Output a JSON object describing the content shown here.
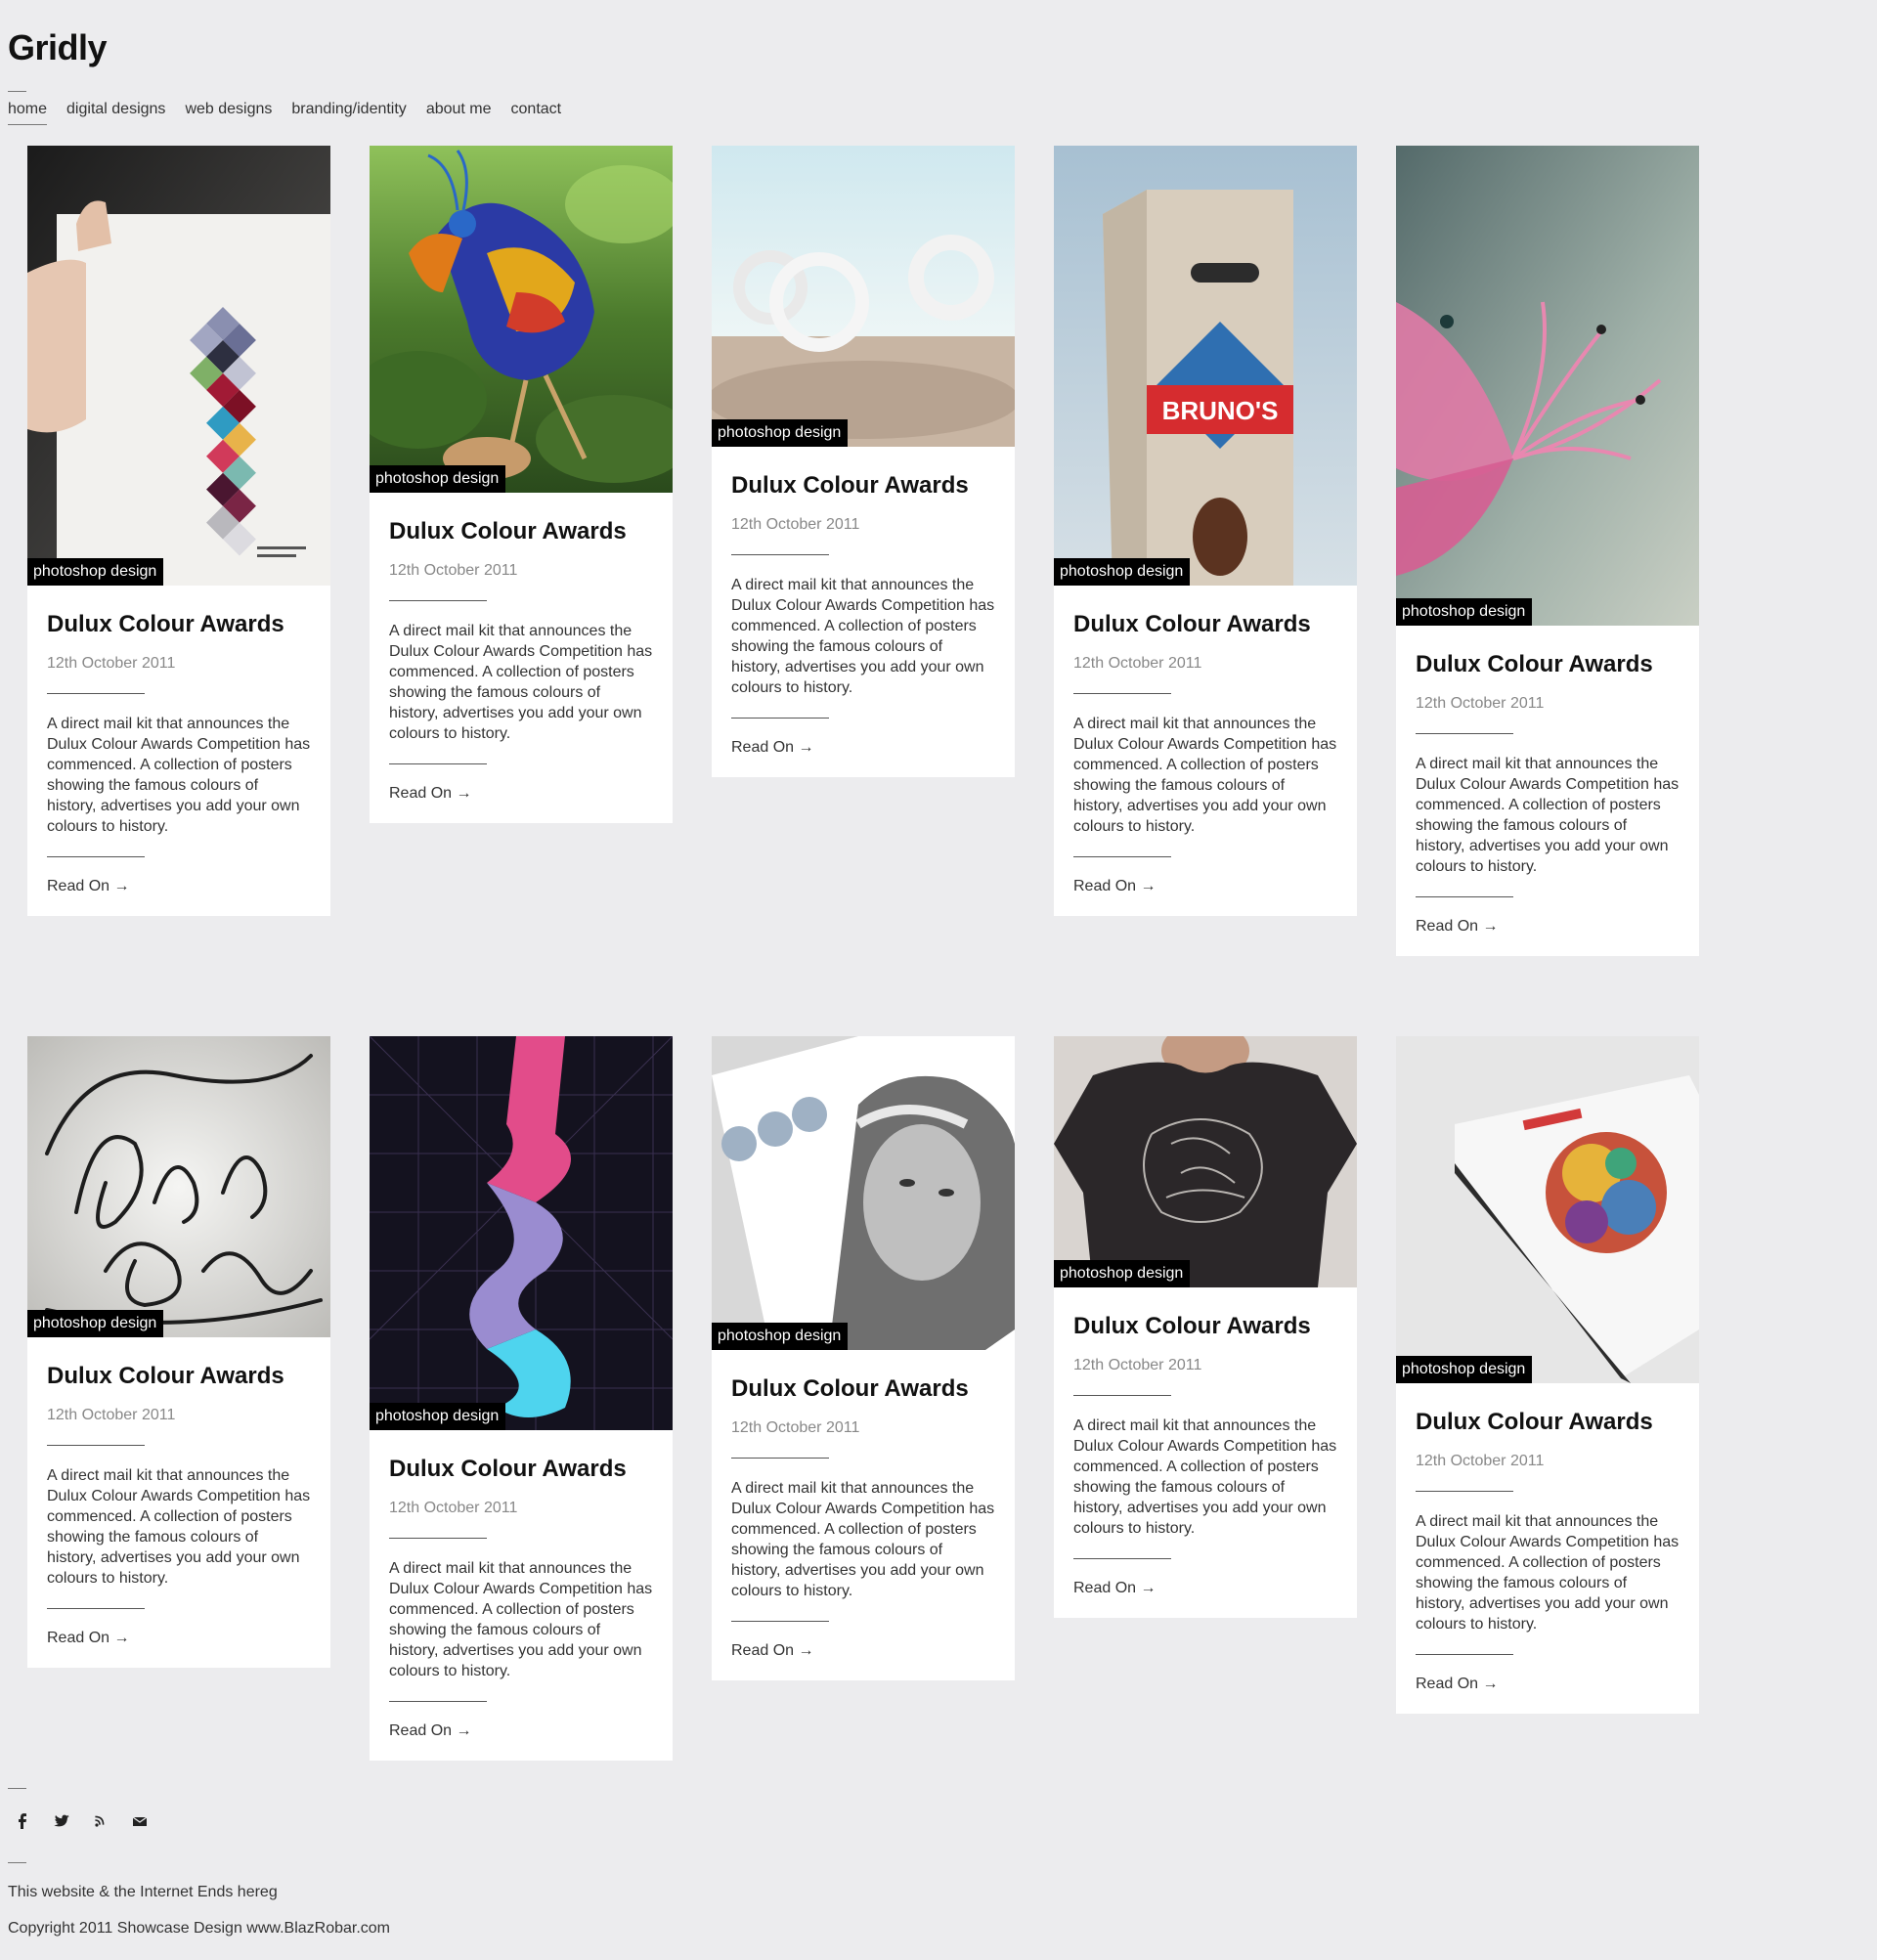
{
  "site": {
    "title": "Gridly"
  },
  "nav": [
    "home",
    "digital designs",
    "web designs",
    "branding/identity",
    "about me",
    "contact"
  ],
  "posts": [
    {
      "category": "photoshop design",
      "title": "Dulux Colour Awards",
      "date": "12th October 2011",
      "excerpt": "A direct mail kit that announces the Dulux Colour Awards Competition has commenced. A collection of posters showing the famous colours of history, advertises you add your own colours to history.",
      "read_more": "Read On →",
      "image": "colour-swatch-poster"
    },
    {
      "category": "photoshop design",
      "title": "Dulux Colour Awards",
      "date": "12th October 2011",
      "excerpt": "A direct mail kit that announces the Dulux Colour Awards Competition has commenced. A collection of posters showing the famous colours of history, advertises you add your own colours to history.",
      "read_more": "Read On →",
      "image": "colourful-bird-jungle"
    },
    {
      "category": "photoshop design",
      "title": "Dulux Colour Awards",
      "date": "12th October 2011",
      "excerpt": "A direct mail kit that announces the Dulux Colour Awards Competition has commenced. A collection of posters showing the famous colours of history, advertises you add your own colours to history.",
      "read_more": "Read On →",
      "image": "rings-desert"
    },
    {
      "category": "photoshop design",
      "title": "Dulux Colour Awards",
      "date": "12th October 2011",
      "excerpt": "A direct mail kit that announces the Dulux Colour Awards Competition has commenced. A collection of posters showing the famous colours of history, advertises you add your own colours to history.",
      "read_more": "Read On →",
      "image": "brunos-coffee-bag",
      "image_text": "BRUNO'S"
    },
    {
      "category": "photoshop design",
      "title": "Dulux Colour Awards",
      "date": "12th October 2011",
      "excerpt": "A direct mail kit that announces the Dulux Colour Awards Competition has commenced. A collection of posters showing the famous colours of history, advertises you add your own colours to history.",
      "read_more": "Read On →",
      "image": "pink-flower"
    },
    {
      "category": "photoshop design",
      "title": "Dulux Colour Awards",
      "date": "12th October 2011",
      "excerpt": "A direct mail kit that announces the Dulux Colour Awards Competition has commenced. A collection of posters showing the famous colours of history, advertises you add your own colours to history.",
      "read_more": "Read On →",
      "image": "calligraphy-lettering"
    },
    {
      "category": "photoshop design",
      "title": "Dulux Colour Awards",
      "date": "12th October 2011",
      "excerpt": "A direct mail kit that announces the Dulux Colour Awards Competition has commenced. A collection of posters showing the famous colours of history, advertises you add your own colours to history.",
      "read_more": "Read On →",
      "image": "neon-ribbon"
    },
    {
      "category": "photoshop design",
      "title": "Dulux Colour Awards",
      "date": "12th October 2011",
      "excerpt": "A direct mail kit that announces the Dulux Colour Awards Competition has commenced. A collection of posters showing the famous colours of history, advertises you add your own colours to history.",
      "read_more": "Read On →",
      "image": "magazine-portrait"
    },
    {
      "category": "photoshop design",
      "title": "Dulux Colour Awards",
      "date": "12th October 2011",
      "excerpt": "A direct mail kit that announces the Dulux Colour Awards Competition has commenced. A collection of posters showing the famous colours of history, advertises you add your own colours to history.",
      "read_more": "Read On →",
      "image": "red-thread-tshirt"
    },
    {
      "category": "photoshop design",
      "title": "Dulux Colour Awards",
      "date": "12th October 2011",
      "excerpt": "A direct mail kit that announces the Dulux Colour Awards Competition has commenced. A collection of posters showing the famous colours of history, advertises you add your own colours to history.",
      "read_more": "Read On →",
      "image": "narnia-book"
    }
  ],
  "social": [
    "facebook-icon",
    "twitter-icon",
    "rss-icon",
    "email-icon"
  ],
  "footer": {
    "line1": "This website & the Internet Ends hereg",
    "line2": "Copyright 2011 Showcase Design www.BlazRobar.com"
  }
}
